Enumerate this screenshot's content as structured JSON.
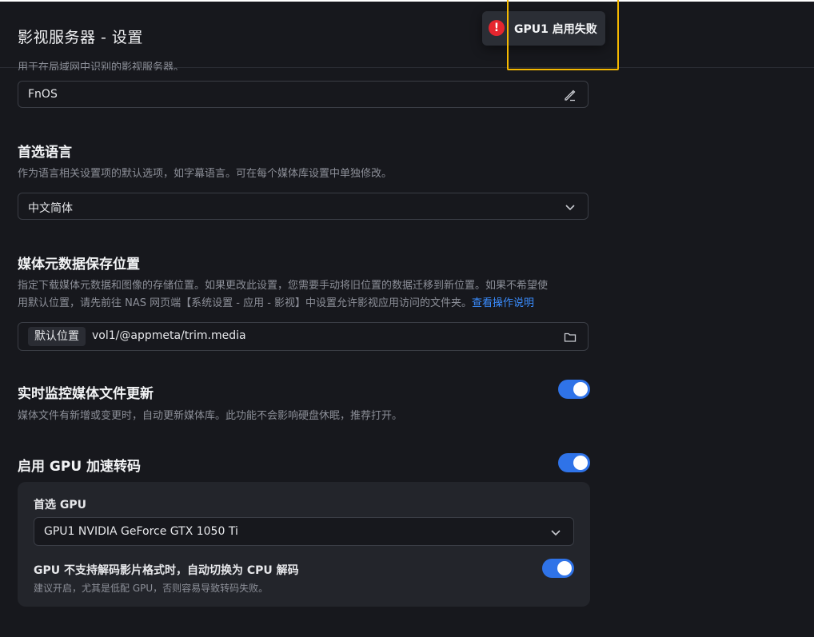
{
  "header": {
    "title": "影视服务器 - 设置"
  },
  "server_name": {
    "description_cut": "用于在局域网中识别的影视服务器。",
    "value": "FnOS",
    "icon": "edit-icon"
  },
  "toast": {
    "icon": "error-icon",
    "message": "GPU1 启用失败",
    "color": "#e5262f"
  },
  "language": {
    "title": "首选语言",
    "description": "作为语言相关设置项的默认选项，如字幕语言。可在每个媒体库设置中单独修改。",
    "value": "中文简体"
  },
  "metadata": {
    "title": "媒体元数据保存位置",
    "description_line1": "指定下载媒体元数据和图像的存储位置。如果更改此设置，您需要手动将旧位置的数据迁移到新位置。如果不希望使",
    "description_line2": "用默认位置，请先前往 NAS 网页端【系统设置 - 应用 - 影视】中设置允许影视应用访问的文件夹。",
    "link": "查看操作说明",
    "chip": "默认位置",
    "path": "vol1/@appmeta/trim.media"
  },
  "monitor": {
    "title": "实时监控媒体文件更新",
    "description": "媒体文件有新增或变更时，自动更新媒体库。此功能不会影响硬盘休眠，推荐打开。",
    "enabled": true
  },
  "gpu": {
    "title": "启用 GPU 加速转码",
    "enabled": true,
    "preferred_label": "首选 GPU",
    "preferred_value": "GPU1 NVIDIA GeForce GTX 1050 Ti",
    "fallback_title": "GPU 不支持解码影片格式时，自动切换为 CPU 解码",
    "fallback_desc": "建议开启，尤其是低配 GPU，否则容易导致转码失败。",
    "fallback_enabled": true
  },
  "colors": {
    "accent": "#2f73e8",
    "link": "#3a8dff",
    "highlight": "#f5b800"
  }
}
